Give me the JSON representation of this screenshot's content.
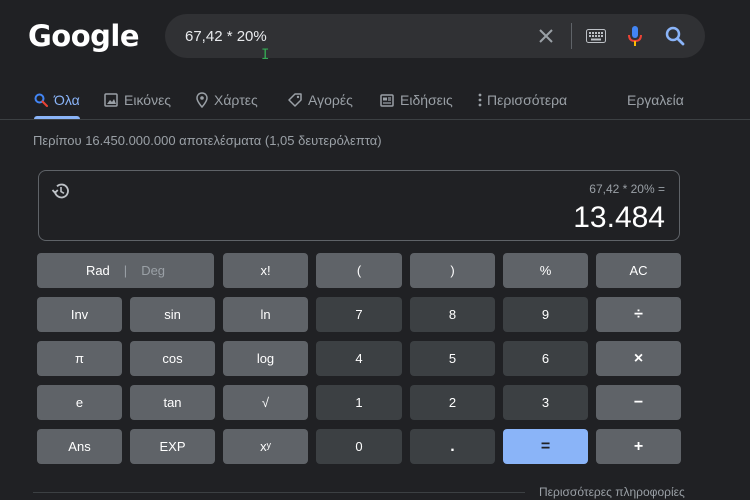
{
  "logo": "Google",
  "search": {
    "value": "67,42 * 20%"
  },
  "tabs": [
    {
      "label": "Όλα",
      "icon": "search-icon",
      "active": true
    },
    {
      "label": "Εικόνες",
      "icon": "image-icon"
    },
    {
      "label": "Χάρτες",
      "icon": "map-pin-icon"
    },
    {
      "label": "Αγορές",
      "icon": "tag-icon"
    },
    {
      "label": "Ειδήσεις",
      "icon": "news-icon"
    },
    {
      "label": "Περισσότερα",
      "icon": "more-vert-icon"
    },
    {
      "label": "Εργαλεία"
    }
  ],
  "result_stats": "Περίπου 16.450.000.000 αποτελέσματα (1,05 δευτερόλεπτα)",
  "calculator": {
    "expression": "67,42 * 20% =",
    "result": "13.484",
    "rad": "Rad",
    "deg": "Deg",
    "keys": [
      [
        "x!",
        "(",
        ")",
        "%",
        "AC"
      ],
      [
        "Inv",
        "sin",
        "ln",
        "7",
        "8",
        "9",
        "÷"
      ],
      [
        "π",
        "cos",
        "log",
        "4",
        "5",
        "6",
        "×"
      ],
      [
        "e",
        "tan",
        "√",
        "1",
        "2",
        "3",
        "−"
      ],
      [
        "Ans",
        "EXP",
        "xʸ",
        "0",
        ".",
        "=",
        "+"
      ]
    ]
  },
  "more_info": "Περισσότερες πληροφορίες",
  "colors": {
    "background": "#202124",
    "accent": "#8ab4f8",
    "key_fn": "#5f6368",
    "key_num": "#3c4043"
  }
}
